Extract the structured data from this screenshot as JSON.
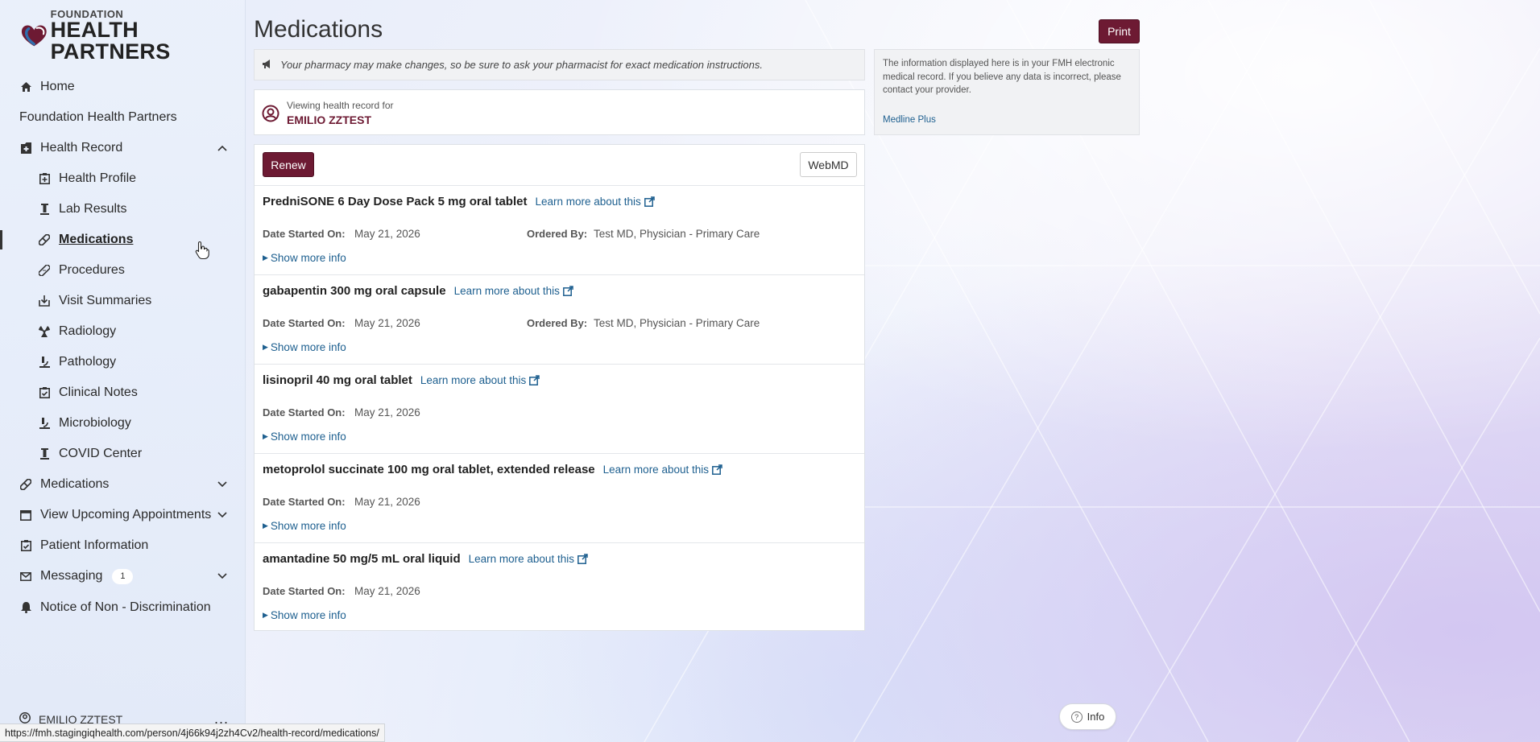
{
  "brand": {
    "top": "FOUNDATION",
    "bottom": "HEALTH PARTNERS"
  },
  "sidebar": {
    "items": [
      {
        "label": "Home",
        "icon": "home-icon"
      },
      {
        "label": "Foundation Health Partners"
      },
      {
        "label": "Health Record",
        "icon": "file-icon",
        "expanded": true
      },
      {
        "label": "Health Profile",
        "icon": "clipboard-icon"
      },
      {
        "label": "Lab Results",
        "icon": "flask-icon"
      },
      {
        "label": "Medications",
        "icon": "pill-icon",
        "active": true
      },
      {
        "label": "Procedures",
        "icon": "bandage-icon"
      },
      {
        "label": "Visit Summaries",
        "icon": "download-icon"
      },
      {
        "label": "Radiology",
        "icon": "radiation-icon"
      },
      {
        "label": "Pathology",
        "icon": "microscope-icon"
      },
      {
        "label": "Clinical Notes",
        "icon": "clipboard-check-icon"
      },
      {
        "label": "Microbiology",
        "icon": "microscope-icon"
      },
      {
        "label": "COVID Center",
        "icon": "flask-icon"
      },
      {
        "label": "Medications",
        "icon": "pill-icon"
      },
      {
        "label": "View Upcoming Appointments",
        "icon": "calendar-icon"
      },
      {
        "label": "Patient Information",
        "icon": "clipboard-check-icon"
      },
      {
        "label": "Messaging",
        "icon": "envelope-icon",
        "badge": "1"
      },
      {
        "label": "Notice of Non - Discrimination",
        "icon": "bell-icon"
      }
    ],
    "user": "EMILIO ZZTEST",
    "user_more": "..."
  },
  "main": {
    "title": "Medications",
    "print_label": "Print",
    "notice": "Your pharmacy may make changes, so be sure to ask your pharmacist for exact medication instructions.",
    "viewing_label": "Viewing health record for",
    "viewing_name": "EMILIO ZZTEST",
    "renew_label": "Renew",
    "webmd_label": "WebMD",
    "learn_more": "Learn more about this",
    "show_more": "Show more info",
    "date_label": "Date Started On:",
    "ordered_label": "Ordered By:",
    "medications": [
      {
        "name": "PredniSONE 6 Day Dose Pack 5 mg oral tablet",
        "date": "May 21, 2026",
        "ordered_by": "Test MD, Physician - Primary Care"
      },
      {
        "name": "gabapentin 300 mg oral capsule",
        "date": "May 21, 2026",
        "ordered_by": "Test MD, Physician - Primary Care"
      },
      {
        "name": "lisinopril 40 mg oral tablet",
        "date": "May 21, 2026"
      },
      {
        "name": "metoprolol succinate 100 mg oral tablet, extended release",
        "date": "May 21, 2026"
      },
      {
        "name": "amantadine 50 mg/5 mL oral liquid",
        "date": "May 21, 2026"
      }
    ]
  },
  "info_box": {
    "text": "The information displayed here is in your FMH electronic medical record. If you believe any data is incorrect, please contact your provider.",
    "link": "Medline Plus"
  },
  "info_button": "Info",
  "status_url": "https://fmh.stagingiqhealth.com/person/4j66k94j2zh4Cv2/health-record/medications/",
  "colors": {
    "brand": "#6d1a33",
    "link": "#1d5f8f"
  }
}
